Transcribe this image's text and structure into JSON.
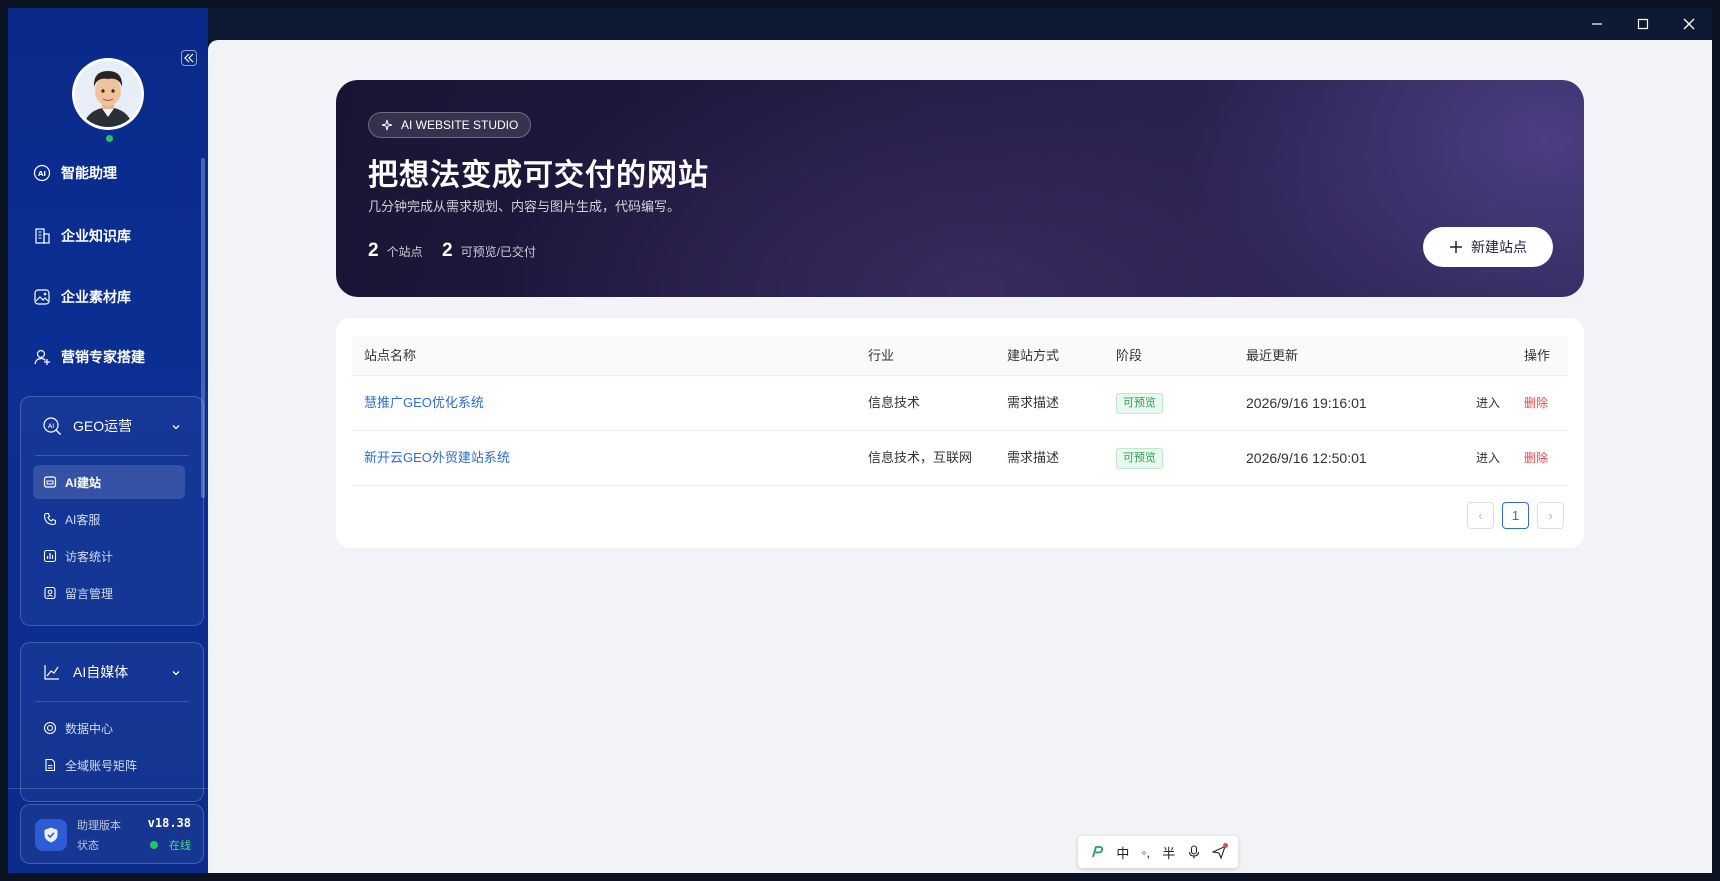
{
  "window": {
    "minimize": "–",
    "maximize": "☐",
    "close": "✕"
  },
  "sidebar": {
    "nav": [
      {
        "label": "智能助理",
        "icon": "ai-icon"
      },
      {
        "label": "企业知识库",
        "icon": "building-icon"
      },
      {
        "label": "企业素材库",
        "icon": "image-icon"
      },
      {
        "label": "营销专家搭建",
        "icon": "user-add-icon"
      }
    ],
    "geo_group": {
      "title": "GEO运营",
      "items": [
        {
          "label": "AI建站",
          "active": true
        },
        {
          "label": "AI客服"
        },
        {
          "label": "访客统计"
        },
        {
          "label": "留言管理"
        }
      ]
    },
    "media_group": {
      "title": "AI自媒体",
      "items": [
        {
          "label": "数据中心"
        },
        {
          "label": "全域账号矩阵"
        }
      ]
    },
    "status": {
      "version_label": "助理版本",
      "version_value": "v18.38",
      "state_label": "状态",
      "state_value": "在线"
    }
  },
  "hero": {
    "badge": "AI WEBSITE STUDIO",
    "title": "把想法变成可交付的网站",
    "subtitle": "几分钟完成从需求规划、内容与图片生成，代码编写。",
    "stats": [
      {
        "value": "2",
        "label": "个站点"
      },
      {
        "value": "2",
        "label": "可预览/已交付"
      }
    ],
    "new_button": "新建站点"
  },
  "table": {
    "columns": [
      "站点名称",
      "行业",
      "建站方式",
      "阶段",
      "最近更新",
      "操作"
    ],
    "rows": [
      {
        "name": "慧推广GEO优化系统",
        "industry": "信息技术",
        "method": "需求描述",
        "stage": "可预览",
        "updated": "2026/9/16 19:16:01",
        "enter": "进入",
        "delete": "删除"
      },
      {
        "name": "新开云GEO外贸建站系统",
        "industry": "信息技术，互联网",
        "method": "需求描述",
        "stage": "可预览",
        "updated": "2026/9/16 12:50:01",
        "enter": "进入",
        "delete": "删除"
      }
    ],
    "pagination": {
      "prev": "‹",
      "current": "1",
      "next": "›"
    }
  },
  "ime": {
    "items": [
      "中",
      "◦,",
      "半"
    ]
  }
}
